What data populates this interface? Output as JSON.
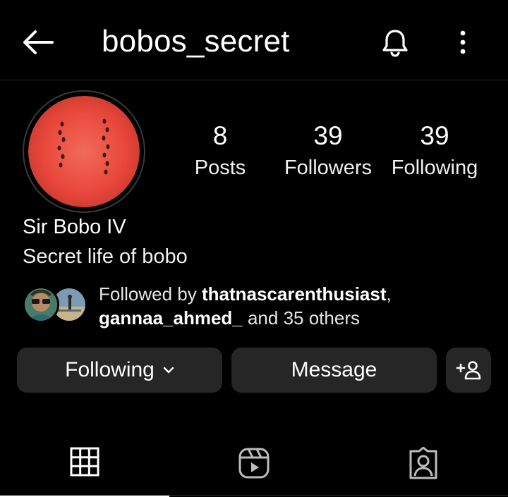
{
  "header": {
    "username": "bobos_secret",
    "icons": {
      "back": "back-arrow-icon",
      "notifications": "bell-icon",
      "menu": "more-vertical-icon"
    }
  },
  "profile": {
    "avatar_icon": "watermelon-avatar",
    "display_name": "Sir Bobo IV",
    "bio": "Secret life of bobo",
    "stats": [
      {
        "value": "8",
        "label": "Posts"
      },
      {
        "value": "39",
        "label": "Followers"
      },
      {
        "value": "39",
        "label": "Following"
      }
    ]
  },
  "mutuals": {
    "prefix": "Followed by ",
    "first": "thatnascarenthusiast",
    "separator": ",",
    "second": "gannaa_ahmed_",
    "suffix": " and 35 others"
  },
  "actions": {
    "following_label": "Following",
    "message_label": "Message",
    "add_icon": "add-person-icon"
  },
  "tabs": {
    "items": [
      {
        "name": "posts-grid",
        "icon": "grid-icon",
        "active": true
      },
      {
        "name": "reels",
        "icon": "reels-icon",
        "active": false
      },
      {
        "name": "tagged",
        "icon": "tagged-person-icon",
        "active": false
      }
    ]
  },
  "colors": {
    "background": "#000000",
    "button": "#262626",
    "text": "#ffffff",
    "watermelon": "#e8463a"
  }
}
